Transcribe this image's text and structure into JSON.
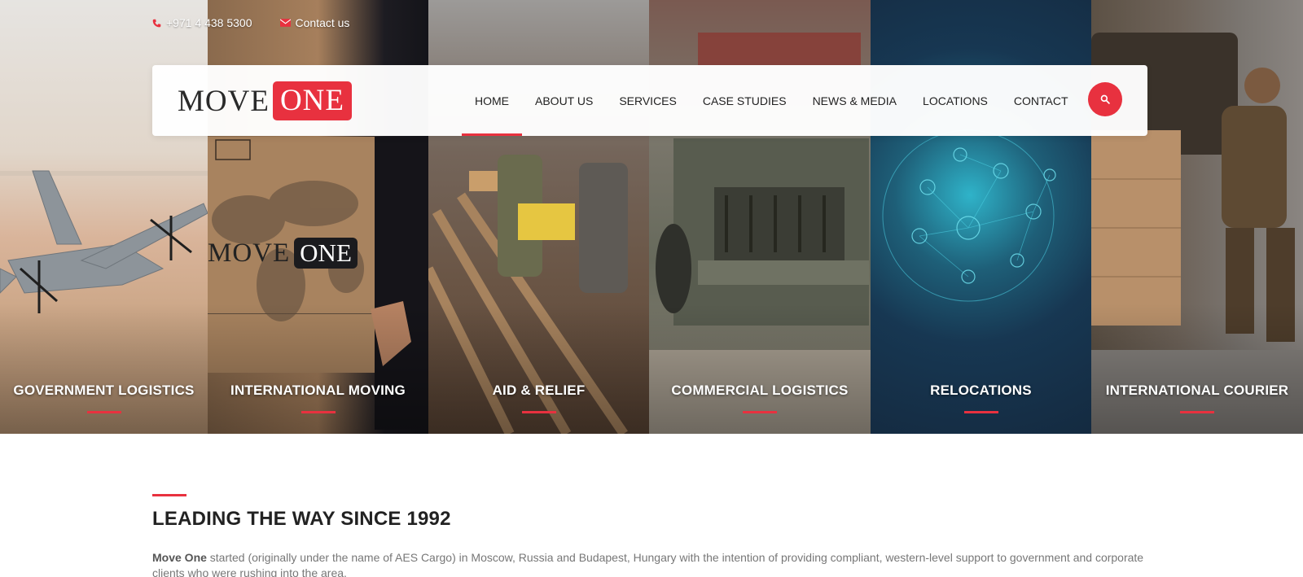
{
  "topbar": {
    "phone": "+971 4 438 5300",
    "contact": "Contact us"
  },
  "logo": {
    "part1": "MOVE",
    "part2": "ONE"
  },
  "nav": {
    "items": [
      "HOME",
      "ABOUT US",
      "SERVICES",
      "CASE STUDIES",
      "NEWS & MEDIA",
      "LOCATIONS",
      "CONTACT"
    ],
    "active": "HOME"
  },
  "tiles": [
    {
      "label": "GOVERNMENT LOGISTICS"
    },
    {
      "label": "INTERNATIONAL MOVING"
    },
    {
      "label": "AID & RELIEF"
    },
    {
      "label": "COMMERCIAL LOGISTICS"
    },
    {
      "label": "RELOCATIONS"
    },
    {
      "label": "INTERNATIONAL COURIER"
    }
  ],
  "box_logo": {
    "part1": "MOVE",
    "part2": "ONE"
  },
  "section": {
    "title": "LEADING THE WAY SINCE 1992",
    "lead": "Move One",
    "body": " started (originally under the name of AES Cargo) in Moscow, Russia and Budapest, Hungary with the intention of providing compliant, western-level support to government and corporate clients who were rushing into the area."
  },
  "colors": {
    "accent": "#e8313f",
    "text": "#222222",
    "muted": "#777777"
  }
}
